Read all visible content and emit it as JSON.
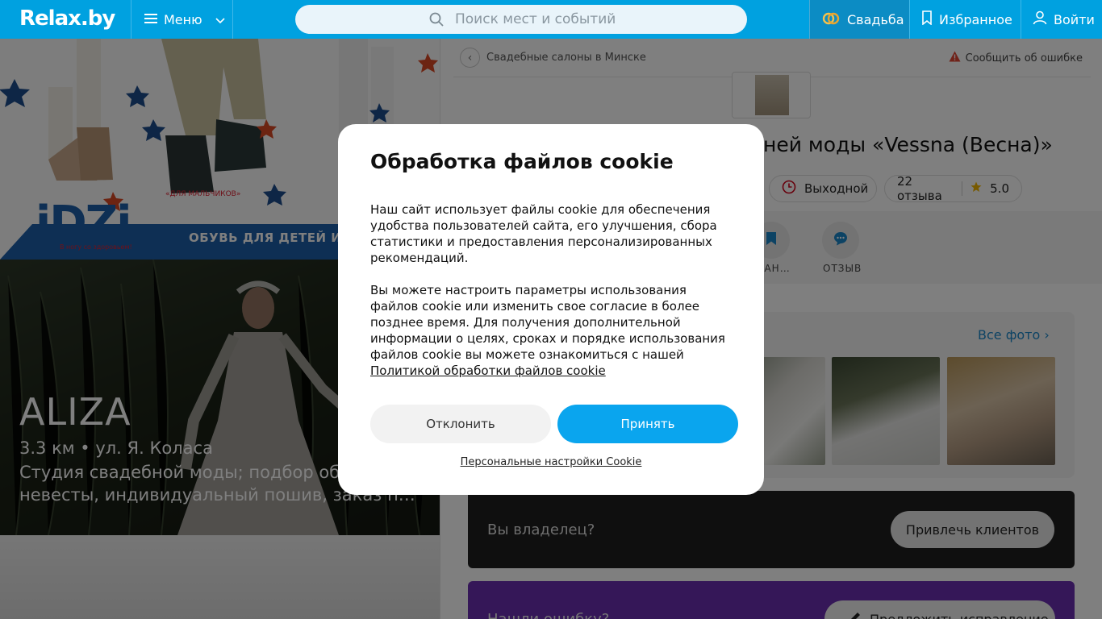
{
  "header": {
    "logo": "Relax.by",
    "menu_label": "Меню",
    "search_placeholder": "Поиск мест и событий",
    "wedding_label": "Свадьба",
    "favorites_label": "Избранное",
    "login_label": "Войти"
  },
  "banner": {
    "brand": "iDZi",
    "brand_sub": "В ногу со здоровьем!",
    "boys_label": "«ДЛЯ МАЛЬЧИКОВ»",
    "tagline": "ОБУВЬ ДЛЯ ДЕТЕЙ И П"
  },
  "hero": {
    "title": "ALIZA",
    "meta": "3.3 км • ул. Я. Коласа",
    "description": "Студия свадебной моды; подбор об… невесты, индивидуальный пошив, заказ п…"
  },
  "place": {
    "breadcrumb": "Свадебные салоны в Минске",
    "report_label": "Сообщить об ошибке",
    "title_visible": "ней моды «Vessna (Весна)»",
    "status": "Выходной",
    "reviews": "22 отзыва",
    "rating": "5.0",
    "action_favorite": "БРАН…",
    "action_review": "ОТЗЫВ",
    "all_photos": "Все фото",
    "owner_prompt": "Вы владелец?",
    "owner_button": "Привлечь клиентов",
    "error_prompt": "Нашли ошибку?",
    "error_button": "Предложить исправление"
  },
  "cookie_modal": {
    "title": "Обработка файлов cookie",
    "paragraph1": "Наш сайт использует файлы cookie для обеспечения удобства пользователей сайта, его улучшения, сбора статистики и предоставления персонализированных рекомендаций.",
    "paragraph2": "Вы можете настроить параметры использования файлов cookie или изменить свое согласие в более позднее время. Для получения дополнительной информации о целях, сроках и порядке использования файлов cookie вы можете ознакомиться с нашей",
    "policy_link": "Политикой обработки файлов cookie",
    "decline": "Отклонить",
    "accept": "Принять",
    "personal_settings": "Персональные настройки Cookie"
  },
  "colors": {
    "brand_blue": "#00a1e0",
    "accept_blue": "#0aa5ee",
    "owner_card": "#1f1f1f",
    "error_card": "#6b2fb0",
    "rating_star": "#f0b400",
    "status_red": "#d0021b"
  }
}
